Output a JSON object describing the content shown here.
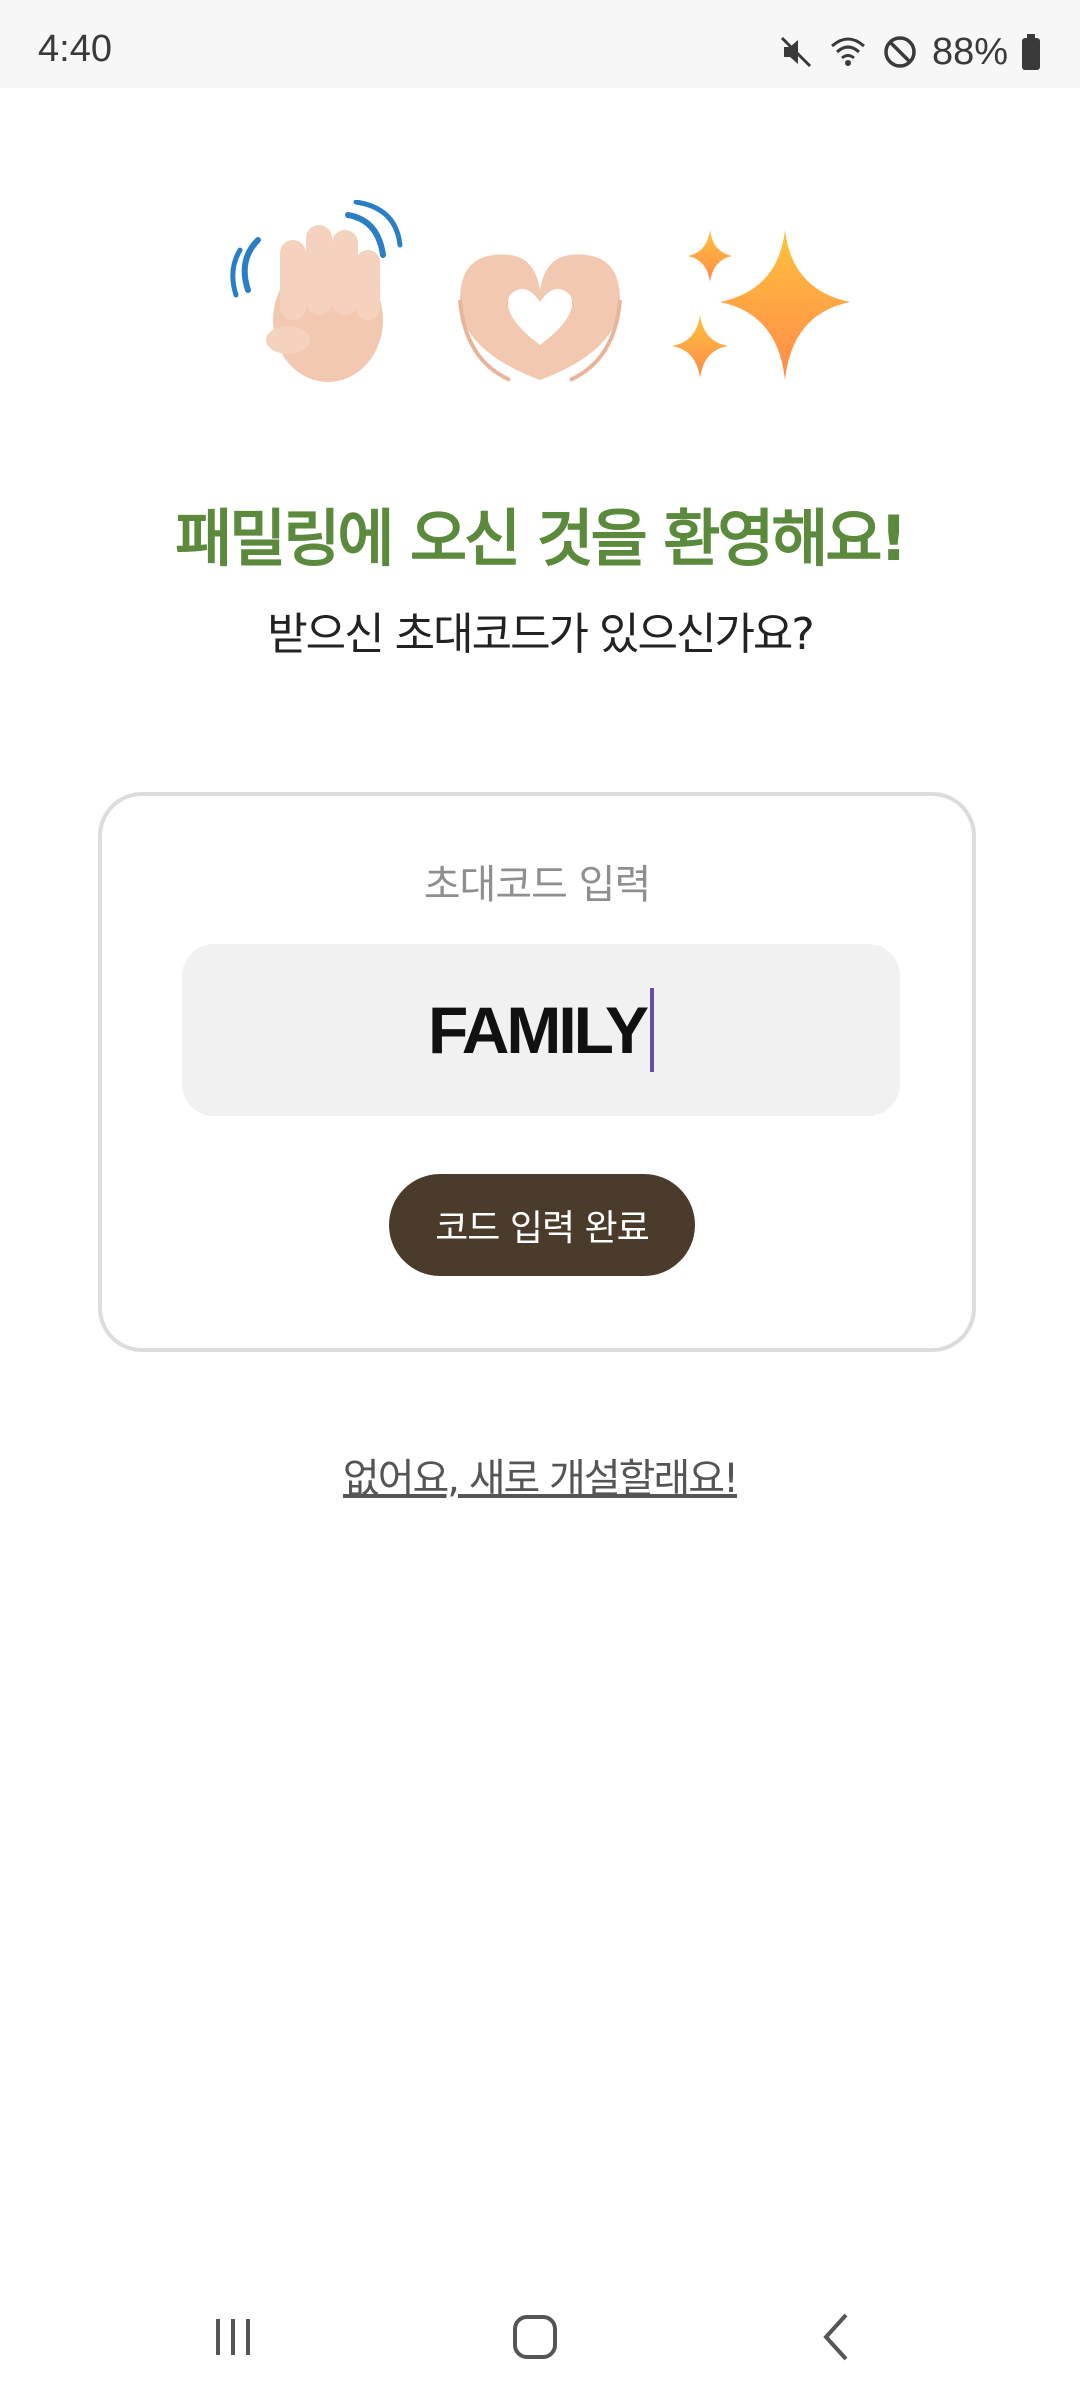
{
  "status_bar": {
    "time": "4:40",
    "battery_percent": "88%",
    "icons": [
      "mute-icon",
      "wifi-icon",
      "do-not-disturb-icon",
      "battery-icon"
    ]
  },
  "emojis": [
    "waving-hand-icon",
    "heart-hands-icon",
    "sparkles-icon"
  ],
  "welcome": {
    "title": "패밀링에 오신 것을 환영해요!",
    "subtitle": "받으신 초대코드가 있으신가요?"
  },
  "card": {
    "label": "초대코드 입력",
    "input_value": "FAMILY",
    "submit_label": "코드 입력 완료"
  },
  "create_link": "없어요, 새로 개설할래요!",
  "colors": {
    "title_green": "#5b8a3c",
    "button_brown": "#4a3b2a",
    "caret_purple": "#6a4fa0"
  },
  "nav_bar": [
    "recent-apps-icon",
    "home-icon",
    "back-icon"
  ]
}
